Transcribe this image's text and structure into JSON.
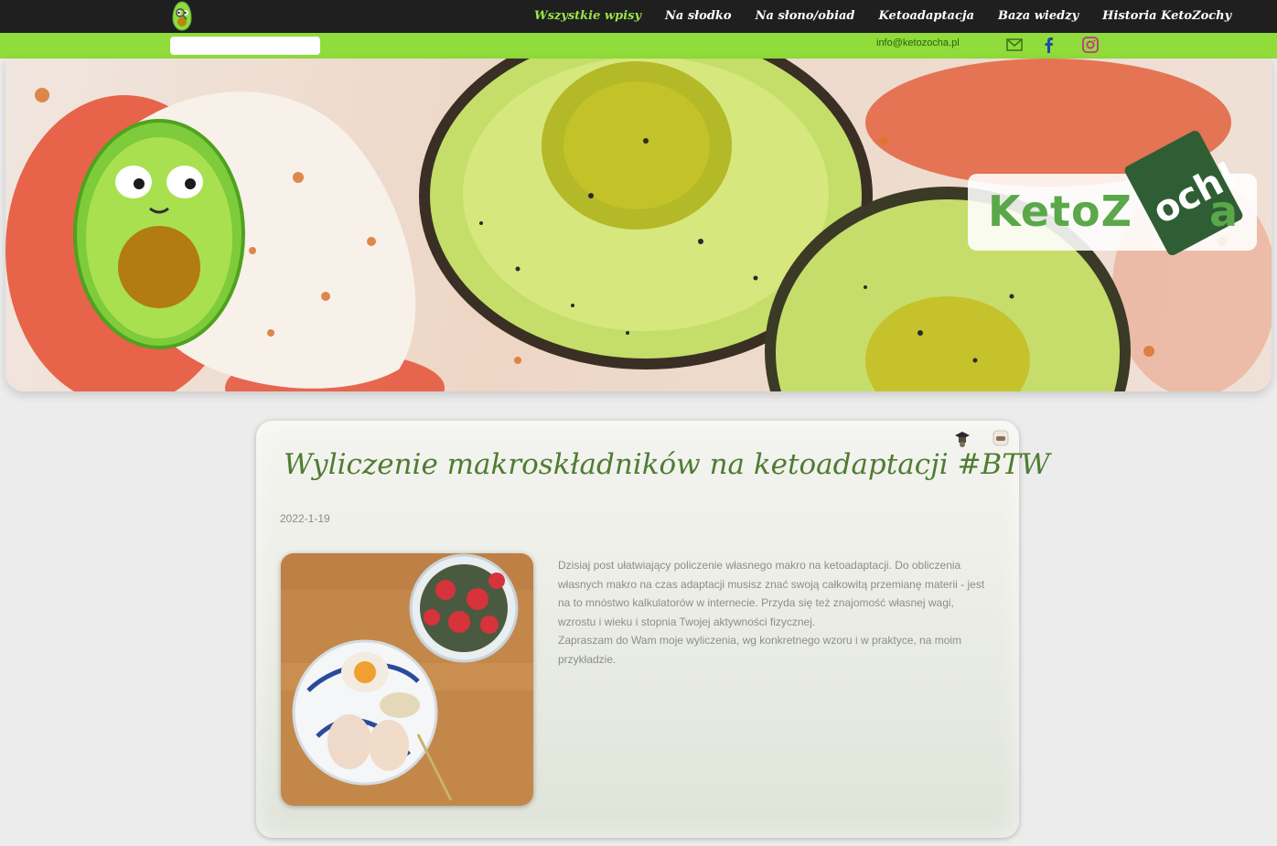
{
  "nav": {
    "items": [
      {
        "label": "Wszystkie wpisy",
        "active": true
      },
      {
        "label": "Na słodko",
        "active": false
      },
      {
        "label": "Na słono/obiad",
        "active": false
      },
      {
        "label": "Ketoadaptacja",
        "active": false
      },
      {
        "label": "Baza wiedzy",
        "active": false
      },
      {
        "label": "Historia KetoZochy",
        "active": false
      }
    ]
  },
  "topbar": {
    "search_placeholder": "",
    "email": "info@ketozocha.pl",
    "social_icons": [
      "mail-icon",
      "facebook-icon",
      "instagram-icon"
    ]
  },
  "hero": {
    "brand_prefix": "KetoZ",
    "brand_suffix": "a",
    "brand_tag": "och!"
  },
  "post": {
    "title": "Wyliczenie makroskładników na ketoadaptacji #BTW",
    "date": "2022-1-19",
    "body": [
      "Dzisiaj post ułatwiający policzenie własnego makro na ketoadaptacji. Do obliczenia własnych makro na czas adaptacji musisz znać swoją całkowitą przemianę materii - jest na to mnóstwo kalkulatorów w internecie. Przyda się też znajomość własnej wagi, wzrostu i wieku i stopnia Twojej aktywności fizycznej.",
      "Zapraszam do Wam moje wyliczenia, wg konkretnego wzoru i w praktyce, na moim przykładzie."
    ]
  },
  "colors": {
    "nav_bg": "#1f1f1f",
    "accent_green": "#8fdc3a",
    "title_green": "#4e7c31",
    "brand_dark": "#2f5e35"
  }
}
